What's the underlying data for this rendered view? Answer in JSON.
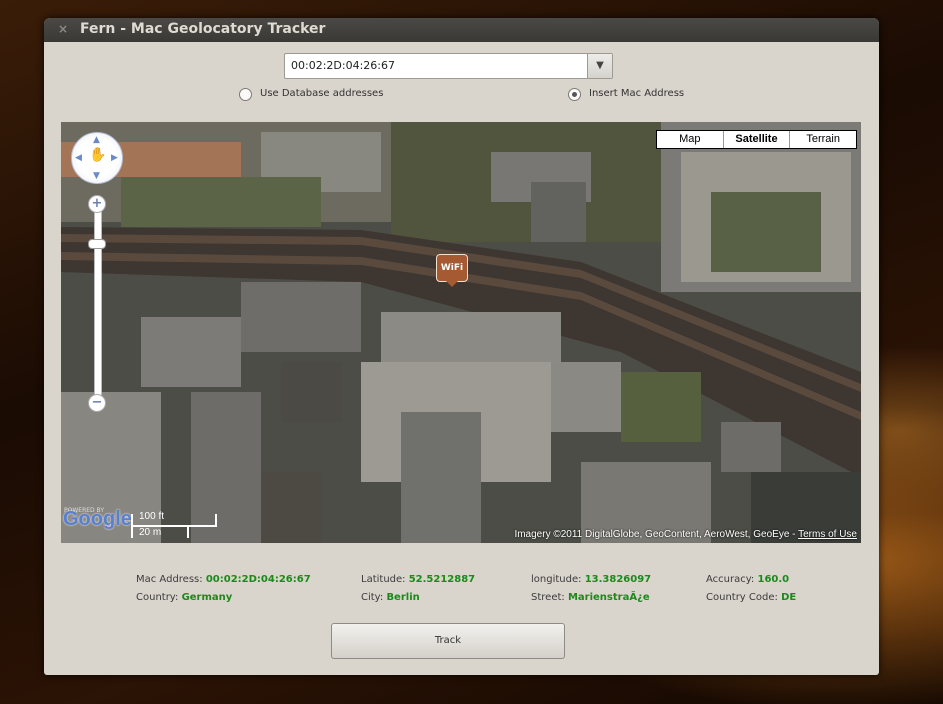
{
  "window": {
    "title": "Fern - Mac Geolocatory Tracker",
    "close_symbol": "×"
  },
  "mac_combo": {
    "value": "00:02:2D:04:26:67",
    "arrow": "▼"
  },
  "radios": [
    {
      "label": "Use Database addresses",
      "checked": false
    },
    {
      "label": "Insert Mac Address",
      "checked": true
    }
  ],
  "map": {
    "types": [
      "Map",
      "Satellite",
      "Terrain"
    ],
    "selected_type": "Satellite",
    "marker_label": "WiFi",
    "logo": "Google",
    "powered_by": "POWERED BY",
    "scale_top": "100 ft",
    "scale_bottom": "20 m",
    "zoom_in": "+",
    "zoom_out": "−",
    "copyright": "Imagery ©2011 DigitalGlobe, GeoContent, AeroWest, GeoEye - ",
    "terms": "Terms of Use"
  },
  "info": {
    "mac_label": "Mac Address:",
    "mac_value": "00:02:2D:04:26:67",
    "lat_label": "Latitude:",
    "lat_value": "52.5212887",
    "lon_label": "longitude:",
    "lon_value": "13.3826097",
    "acc_label": "Accuracy:",
    "acc_value": "160.0",
    "country_label": "Country:",
    "country_value": "Germany",
    "city_label": "City:",
    "city_value": "Berlin",
    "street_label": "Street:",
    "street_value": "MarienstraÃ¿e",
    "code_label": "Country Code:",
    "code_value": "DE"
  },
  "track_button": "Track"
}
